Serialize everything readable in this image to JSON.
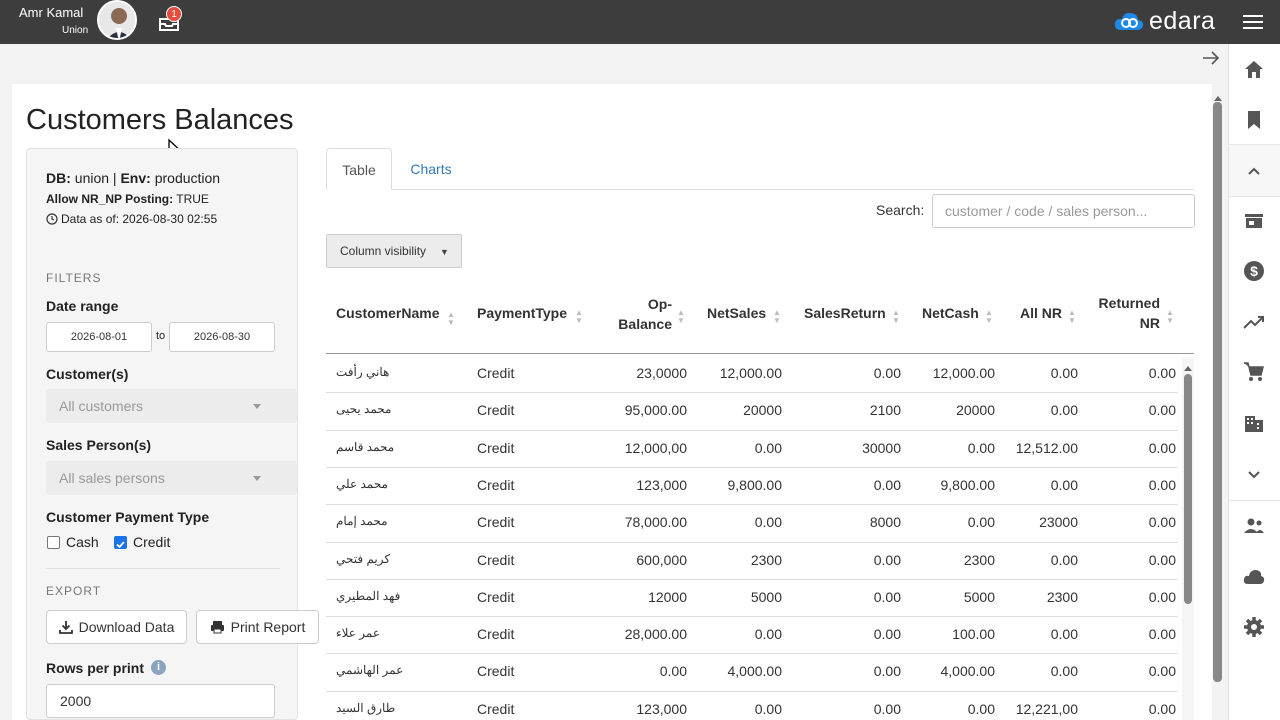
{
  "header": {
    "user_name": "Amr Kamal",
    "user_org": "Union",
    "notification_count": "1",
    "brand": "edara"
  },
  "page": {
    "title": "Customers Balances"
  },
  "filters": {
    "db_label": "DB:",
    "db_value": "union",
    "env_label": "Env:",
    "env_value": "production",
    "allow_label": "Allow NR_NP Posting:",
    "allow_value": "TRUE",
    "data_as_of": "Data as of: 2026-08-30 02:55",
    "section_filters": "FILTERS",
    "date_range_label": "Date range",
    "date_from": "2026-08-01",
    "date_to_sep": "to",
    "date_to": "2026-08-30",
    "customers_label": "Customer(s)",
    "customers_placeholder": "All customers",
    "sales_label": "Sales Person(s)",
    "sales_placeholder": "All sales persons",
    "payment_type_label": "Customer Payment Type",
    "cash_label": "Cash",
    "cash_checked": false,
    "credit_label": "Credit",
    "credit_checked": true,
    "section_export": "EXPORT",
    "download_label": "Download Data",
    "print_label": "Print Report",
    "rows_per_print_label": "Rows per print",
    "rows_per_print_value": "2000"
  },
  "tabs": {
    "table": "Table",
    "charts": "Charts"
  },
  "search": {
    "label": "Search:",
    "placeholder": "customer / code / sales person..."
  },
  "column_visibility": "Column visibility",
  "table": {
    "headers": {
      "name": "CustomerName",
      "payment": "PaymentType",
      "opbalance_1": "Op-",
      "opbalance_2": "Balance",
      "netsales": "NetSales",
      "salesreturn": "SalesReturn",
      "netcash": "NetCash",
      "allnr": "All NR",
      "returned_1": "Returned",
      "returned_2": "NR"
    },
    "rows": [
      {
        "name": "هاني رأفت",
        "payment": "Credit",
        "op": "23,0000",
        "netsales": "12,000.00",
        "salesreturn": "0.00",
        "netcash": "12,000.00",
        "allnr": "0.00",
        "returned": "0.00"
      },
      {
        "name": "محمد يحيى",
        "payment": "Credit",
        "op": "95,000.00",
        "netsales": "20000",
        "salesreturn": "2100",
        "netcash": "20000",
        "allnr": "0.00",
        "returned": "0.00"
      },
      {
        "name": "محمد قاسم",
        "payment": "Credit",
        "op": "12,000,00",
        "netsales": "0.00",
        "salesreturn": "30000",
        "netcash": "0.00",
        "allnr": "12,512.00",
        "returned": "0.00"
      },
      {
        "name": "محمد علي",
        "payment": "Credit",
        "op": "123,000",
        "netsales": "9,800.00",
        "salesreturn": "0.00",
        "netcash": "9,800.00",
        "allnr": "0.00",
        "returned": "0.00"
      },
      {
        "name": "محمد إمام",
        "payment": "Credit",
        "op": "78,000.00",
        "netsales": "0.00",
        "salesreturn": "8000",
        "netcash": "0.00",
        "allnr": "23000",
        "returned": "0.00"
      },
      {
        "name": "كريم فتحي",
        "payment": "Credit",
        "op": "600,000",
        "netsales": "2300",
        "salesreturn": "0.00",
        "netcash": "2300",
        "allnr": "0.00",
        "returned": "0.00"
      },
      {
        "name": "فهد المطيري",
        "payment": "Credit",
        "op": "12000",
        "netsales": "5000",
        "salesreturn": "0.00",
        "netcash": "5000",
        "allnr": "2300",
        "returned": "0.00"
      },
      {
        "name": "عمر علاء",
        "payment": "Credit",
        "op": "28,000.00",
        "netsales": "0.00",
        "salesreturn": "0.00",
        "netcash": "100.00",
        "allnr": "0.00",
        "returned": "0.00"
      },
      {
        "name": "عمر الهاشمي",
        "payment": "Credit",
        "op": "0.00",
        "netsales": "4,000.00",
        "salesreturn": "0.00",
        "netcash": "4,000.00",
        "allnr": "0.00",
        "returned": "0.00"
      },
      {
        "name": "طارق السيد",
        "payment": "Credit",
        "op": "123,000",
        "netsales": "0.00",
        "salesreturn": "0.00",
        "netcash": "0.00",
        "allnr": "12,221,00",
        "returned": "0.00"
      }
    ]
  },
  "right_nav": [
    "home-icon",
    "bookmark-icon",
    "chevron-up-icon",
    "store-icon",
    "dollar-icon",
    "trending-icon",
    "cart-icon",
    "building-icon",
    "chevron-down-icon",
    "people-icon",
    "cloud-icon",
    "settings-icon"
  ],
  "colors": {
    "topbar": "#3d3d3d",
    "brand_blue": "#1e88e5",
    "link": "#337ab7",
    "badge": "#e74c3c",
    "check": "#1a73e8"
  }
}
